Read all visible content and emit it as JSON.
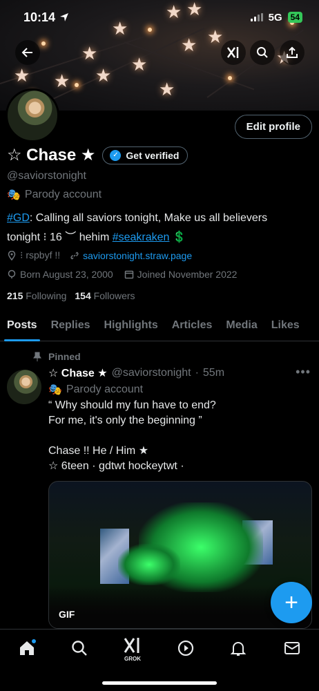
{
  "status_bar": {
    "time": "10:14",
    "network": "5G",
    "battery": "54"
  },
  "profile": {
    "name": "☆ Chase ★",
    "get_verified_label": "Get verified",
    "handle": "@saviorstonight",
    "parody_label": "Parody account",
    "edit_profile_label": "Edit profile",
    "bio_hashtag_gd": "#GD",
    "bio_line1_rest": ": Calling all saviors tonight, Make us all believers",
    "bio_line2_start": "tonight  ⁝  16 ︶ hehim ",
    "bio_hashtag_seakraken": "#seakraken",
    "bio_line2_end": " 💲",
    "location": "⁝ rspbyf !!",
    "website": "saviorstonight.straw.page",
    "born": "Born August 23, 2000",
    "joined": "Joined November 2022",
    "following_count": "215",
    "following_label": "Following",
    "followers_count": "154",
    "followers_label": "Followers"
  },
  "tabs": [
    "Posts",
    "Replies",
    "Highlights",
    "Articles",
    "Media",
    "Likes"
  ],
  "post": {
    "pinned_label": "Pinned",
    "author_name": "☆ Chase ★",
    "author_handle": "@saviorstonight",
    "time": "55m",
    "parody_label": "Parody account",
    "text": "“ Why should my fun have to end?\nFor me, it's only the beginning ”\n\nChase   !!   He / Him ★\n ☆ 6teen · gdtwt hockeytwt  ·",
    "media_badge": "GIF"
  },
  "fab_label": "+",
  "bottom_nav": {
    "grok_label": "GROK"
  },
  "colors": {
    "accent": "#1d9bf0",
    "muted": "#71767b",
    "background": "#000000"
  },
  "icons": [
    "back-arrow-icon",
    "grok-icon",
    "search-icon",
    "share-icon",
    "location-icon",
    "link-icon",
    "birthday-icon",
    "calendar-icon",
    "pin-icon",
    "more-icon",
    "home-icon",
    "play-icon",
    "bell-icon",
    "mail-icon"
  ]
}
